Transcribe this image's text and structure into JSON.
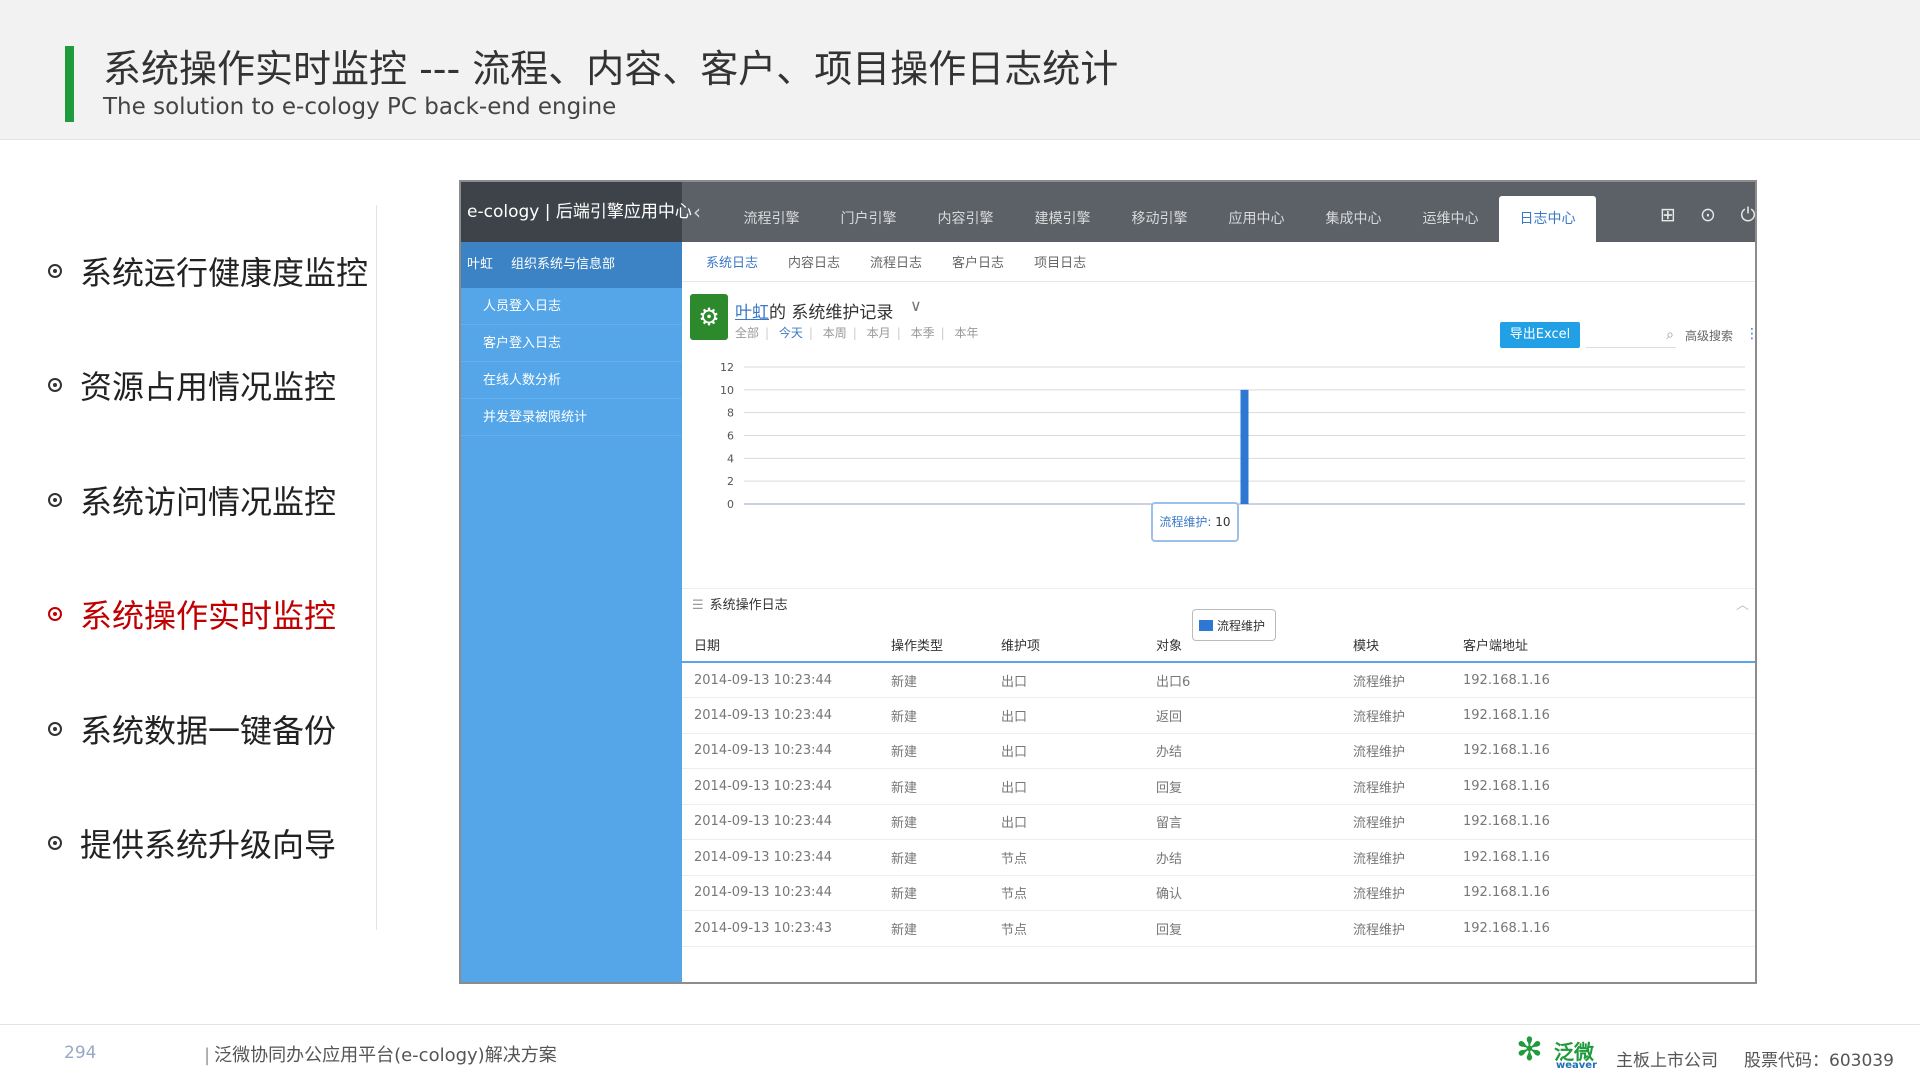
{
  "slide": {
    "title": "系统操作实时监控  --- 流程、内容、客户、项目操作日志统计",
    "subtitle": "The solution to e-cology PC back-end engine"
  },
  "bullets": [
    {
      "label": "系统运行健康度监控",
      "active": false
    },
    {
      "label": "资源占用情况监控",
      "active": false
    },
    {
      "label": "系统访问情况监控",
      "active": false
    },
    {
      "label": "系统操作实时监控",
      "active": true
    },
    {
      "label": "系统数据一键备份",
      "active": false
    },
    {
      "label": "提供系统升级向导",
      "active": false
    }
  ],
  "app": {
    "brand": "e-cology | 后端引擎应用中心",
    "nav_tabs": [
      "流程引擎",
      "门户引擎",
      "内容引擎",
      "建模引擎",
      "移动引擎",
      "应用中心",
      "集成中心",
      "运维中心",
      "日志中心"
    ],
    "active_tab": "日志中心",
    "sidebar": {
      "user": "叶虹",
      "dept": "组织系统与信息部",
      "items": [
        "人员登入日志",
        "客户登入日志",
        "在线人数分析",
        "并发登录被限统计"
      ]
    },
    "subnav": [
      "系统日志",
      "内容日志",
      "流程日志",
      "客户日志",
      "项目日志"
    ],
    "active_subnav": "系统日志",
    "panel": {
      "user_link": "叶虹",
      "title_suffix": "的  系统维护记录",
      "filters": [
        "全部",
        "今天",
        "本周",
        "本月",
        "本季",
        "本年"
      ],
      "active_filter": "今天",
      "export_label": "导出Excel",
      "adv_search_label": "高级搜索"
    },
    "tooltip": {
      "label": "流程维护:",
      "value": "10"
    },
    "log_section_title": "系统操作日志",
    "table": {
      "columns": [
        "日期",
        "操作类型",
        "维护项",
        "对象",
        "模块",
        "客户端地址"
      ],
      "rows": [
        [
          "2014-09-13 10:23:44",
          "新建",
          "出口",
          "出口6",
          "流程维护",
          "192.168.1.16"
        ],
        [
          "2014-09-13 10:23:44",
          "新建",
          "出口",
          "返回",
          "流程维护",
          "192.168.1.16"
        ],
        [
          "2014-09-13 10:23:44",
          "新建",
          "出口",
          "办结",
          "流程维护",
          "192.168.1.16"
        ],
        [
          "2014-09-13 10:23:44",
          "新建",
          "出口",
          "回复",
          "流程维护",
          "192.168.1.16"
        ],
        [
          "2014-09-13 10:23:44",
          "新建",
          "出口",
          "留言",
          "流程维护",
          "192.168.1.16"
        ],
        [
          "2014-09-13 10:23:44",
          "新建",
          "节点",
          "办结",
          "流程维护",
          "192.168.1.16"
        ],
        [
          "2014-09-13 10:23:44",
          "新建",
          "节点",
          "确认",
          "流程维护",
          "192.168.1.16"
        ],
        [
          "2014-09-13 10:23:43",
          "新建",
          "节点",
          "回复",
          "流程维护",
          "192.168.1.16"
        ]
      ]
    }
  },
  "chart_data": {
    "type": "bar",
    "series": [
      {
        "name": "流程维护",
        "values": [
          10
        ]
      }
    ],
    "y_ticks": [
      0,
      2,
      4,
      6,
      8,
      10,
      12
    ],
    "ylim": [
      0,
      12
    ],
    "grid": true,
    "legend": "bottom-center",
    "color": "#2e78d4"
  },
  "footer": {
    "page_number": "294",
    "text": "泛微协同办公应用平台(e-cology)解决方案",
    "logo_cn": "泛微",
    "logo_en": "weaver",
    "listed": "主板上市公司",
    "stock": "股票代码：603039"
  }
}
